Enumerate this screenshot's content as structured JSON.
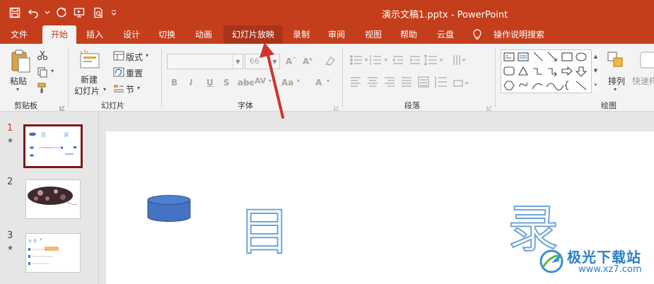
{
  "title_bar": {
    "document_title": "演示文稿1.pptx  -  PowerPoint"
  },
  "menu_tabs": [
    {
      "label": "文件"
    },
    {
      "label": "开始"
    },
    {
      "label": "插入"
    },
    {
      "label": "设计"
    },
    {
      "label": "切换"
    },
    {
      "label": "动画"
    },
    {
      "label": "幻灯片放映"
    },
    {
      "label": "录制"
    },
    {
      "label": "审阅"
    },
    {
      "label": "视图"
    },
    {
      "label": "帮助"
    },
    {
      "label": "云盘"
    },
    {
      "label": "操作说明搜索"
    }
  ],
  "ribbon": {
    "clipboard": {
      "paste_label": "粘贴",
      "group_label": "剪贴板"
    },
    "slides": {
      "new_slide_label_1": "新建",
      "new_slide_label_2": "幻灯片",
      "layout_label": "版式",
      "reset_label": "重置",
      "section_label": "节",
      "group_label": "幻灯片"
    },
    "font": {
      "font_size_value": "66",
      "group_label": "字体"
    },
    "paragraph": {
      "group_label": "段落"
    },
    "drawing": {
      "arrange_label": "排列",
      "quick_style_label": "快速样",
      "group_label": "绘图"
    }
  },
  "slides_pane": {
    "items": [
      {
        "number": "1",
        "starred": true,
        "selected": true
      },
      {
        "number": "2",
        "starred": false,
        "selected": false
      },
      {
        "number": "3",
        "starred": true,
        "selected": false
      }
    ]
  },
  "slide": {
    "char_1": "目",
    "char_2": "录"
  },
  "watermark": {
    "text": "极光下载站",
    "url": "www.xz7.com"
  },
  "colors": {
    "accent": "#c43e1c",
    "ribbon_bg": "#f3f3f3",
    "annotation_arrow": "#d0342c",
    "shape_fill": "#4472c4"
  }
}
